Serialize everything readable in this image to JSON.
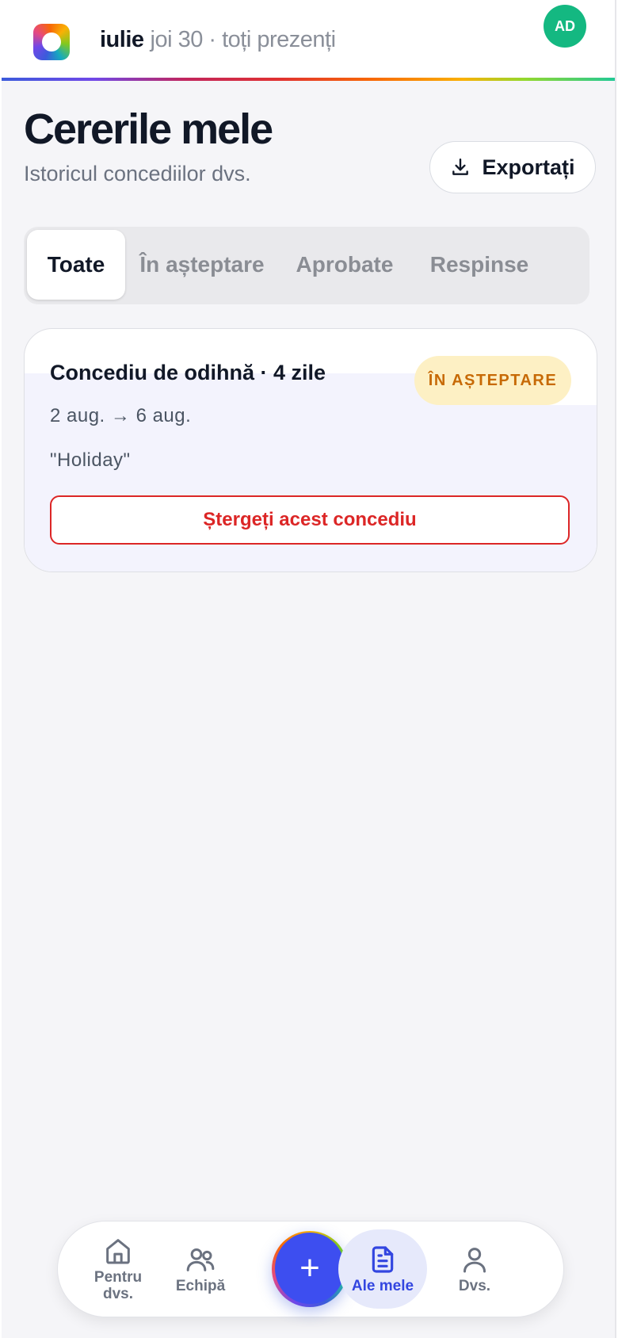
{
  "header": {
    "month": "iulie",
    "status": "joi 30 · toți prezenți",
    "avatar_initials": "AD"
  },
  "page": {
    "title": "Cererile mele",
    "subtitle": "Istoricul concediilor dvs.",
    "export_label": "Exportați"
  },
  "tabs": [
    {
      "label": "Toate",
      "active": true
    },
    {
      "label": "În așteptare",
      "active": false
    },
    {
      "label": "Aprobate",
      "active": false
    },
    {
      "label": "Respinse",
      "active": false
    }
  ],
  "requests": [
    {
      "title": "Concediu de odihnă · 4 zile",
      "status": "ÎN AȘTEPTARE",
      "dates": "2 aug. → 6 aug.",
      "note": "\"Holiday\"",
      "delete_label": "Ștergeți acest concediu"
    }
  ],
  "bottom_nav": {
    "items": [
      {
        "label": "Pentru dvs.",
        "icon": "home-icon"
      },
      {
        "label": "Echipă",
        "icon": "users-icon"
      },
      {
        "label": "Ale mele",
        "icon": "document-icon",
        "active": true
      },
      {
        "label": "Dvs.",
        "icon": "user-icon"
      }
    ],
    "fab_label": "+"
  },
  "colors": {
    "accent": "#3d4ef0",
    "pending_bg": "#fdf0c4",
    "pending_text": "#c76a06",
    "danger": "#dc2626",
    "avatar": "#14b881"
  }
}
